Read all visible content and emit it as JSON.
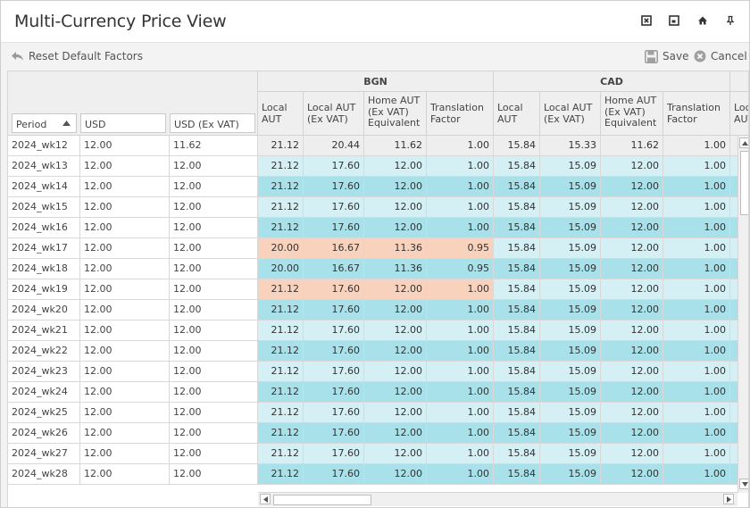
{
  "window": {
    "title": "Multi-Currency Price View",
    "icons": [
      "close-icon",
      "restore-icon",
      "home-icon",
      "pin-icon"
    ]
  },
  "toolbar": {
    "reset_label": "Reset Default Factors",
    "save_label": "Save",
    "cancel_label": "Cancel"
  },
  "grid": {
    "fixed_columns": [
      "Period",
      "USD",
      "USD (Ex VAT)"
    ],
    "sort_column": "Period",
    "groups": [
      {
        "name": "BGN",
        "columns": [
          "Local AUT",
          "Local AUT (Ex VAT)",
          "Home AUT (Ex VAT) Equivalent",
          "Translation Factor"
        ]
      },
      {
        "name": "CAD",
        "columns": [
          "Local AUT",
          "Local AUT (Ex VAT)",
          "Home AUT (Ex VAT) Equivalent",
          "Translation Factor"
        ]
      }
    ],
    "partial_column": "Local AUT",
    "rows": [
      {
        "period": "2024_wk12",
        "usd": "12.00",
        "usd_ex": "11.62",
        "tone": "grey",
        "bgn": [
          "21.12",
          "20.44",
          "11.62",
          "1.00"
        ],
        "cad": [
          "15.84",
          "15.33",
          "11.62",
          "1.00"
        ]
      },
      {
        "period": "2024_wk13",
        "usd": "12.00",
        "usd_ex": "12.00",
        "tone": "light",
        "bgn": [
          "21.12",
          "17.60",
          "12.00",
          "1.00"
        ],
        "cad": [
          "15.84",
          "15.09",
          "12.00",
          "1.00"
        ]
      },
      {
        "period": "2024_wk14",
        "usd": "12.00",
        "usd_ex": "12.00",
        "tone": "dark",
        "bgn": [
          "21.12",
          "17.60",
          "12.00",
          "1.00"
        ],
        "cad": [
          "15.84",
          "15.09",
          "12.00",
          "1.00"
        ]
      },
      {
        "period": "2024_wk15",
        "usd": "12.00",
        "usd_ex": "12.00",
        "tone": "light",
        "bgn": [
          "21.12",
          "17.60",
          "12.00",
          "1.00"
        ],
        "cad": [
          "15.84",
          "15.09",
          "12.00",
          "1.00"
        ]
      },
      {
        "period": "2024_wk16",
        "usd": "12.00",
        "usd_ex": "12.00",
        "tone": "dark",
        "bgn": [
          "21.12",
          "17.60",
          "12.00",
          "1.00"
        ],
        "cad": [
          "15.84",
          "15.09",
          "12.00",
          "1.00"
        ]
      },
      {
        "period": "2024_wk17",
        "usd": "12.00",
        "usd_ex": "12.00",
        "tone": "salmon",
        "bgn": [
          "20.00",
          "16.67",
          "11.36",
          "0.95"
        ],
        "cad": [
          "15.84",
          "15.09",
          "12.00",
          "1.00"
        ]
      },
      {
        "period": "2024_wk18",
        "usd": "12.00",
        "usd_ex": "12.00",
        "tone": "dark",
        "bgn": [
          "20.00",
          "16.67",
          "11.36",
          "0.95"
        ],
        "cad": [
          "15.84",
          "15.09",
          "12.00",
          "1.00"
        ]
      },
      {
        "period": "2024_wk19",
        "usd": "12.00",
        "usd_ex": "12.00",
        "tone": "salmon",
        "bgn": [
          "21.12",
          "17.60",
          "12.00",
          "1.00"
        ],
        "cad": [
          "15.84",
          "15.09",
          "12.00",
          "1.00"
        ]
      },
      {
        "period": "2024_wk20",
        "usd": "12.00",
        "usd_ex": "12.00",
        "tone": "dark",
        "bgn": [
          "21.12",
          "17.60",
          "12.00",
          "1.00"
        ],
        "cad": [
          "15.84",
          "15.09",
          "12.00",
          "1.00"
        ]
      },
      {
        "period": "2024_wk21",
        "usd": "12.00",
        "usd_ex": "12.00",
        "tone": "light",
        "bgn": [
          "21.12",
          "17.60",
          "12.00",
          "1.00"
        ],
        "cad": [
          "15.84",
          "15.09",
          "12.00",
          "1.00"
        ]
      },
      {
        "period": "2024_wk22",
        "usd": "12.00",
        "usd_ex": "12.00",
        "tone": "dark",
        "bgn": [
          "21.12",
          "17.60",
          "12.00",
          "1.00"
        ],
        "cad": [
          "15.84",
          "15.09",
          "12.00",
          "1.00"
        ]
      },
      {
        "period": "2024_wk23",
        "usd": "12.00",
        "usd_ex": "12.00",
        "tone": "light",
        "bgn": [
          "21.12",
          "17.60",
          "12.00",
          "1.00"
        ],
        "cad": [
          "15.84",
          "15.09",
          "12.00",
          "1.00"
        ]
      },
      {
        "period": "2024_wk24",
        "usd": "12.00",
        "usd_ex": "12.00",
        "tone": "dark",
        "bgn": [
          "21.12",
          "17.60",
          "12.00",
          "1.00"
        ],
        "cad": [
          "15.84",
          "15.09",
          "12.00",
          "1.00"
        ]
      },
      {
        "period": "2024_wk25",
        "usd": "12.00",
        "usd_ex": "12.00",
        "tone": "light",
        "bgn": [
          "21.12",
          "17.60",
          "12.00",
          "1.00"
        ],
        "cad": [
          "15.84",
          "15.09",
          "12.00",
          "1.00"
        ]
      },
      {
        "period": "2024_wk26",
        "usd": "12.00",
        "usd_ex": "12.00",
        "tone": "dark",
        "bgn": [
          "21.12",
          "17.60",
          "12.00",
          "1.00"
        ],
        "cad": [
          "15.84",
          "15.09",
          "12.00",
          "1.00"
        ]
      },
      {
        "period": "2024_wk27",
        "usd": "12.00",
        "usd_ex": "12.00",
        "tone": "light",
        "bgn": [
          "21.12",
          "17.60",
          "12.00",
          "1.00"
        ],
        "cad": [
          "15.84",
          "15.09",
          "12.00",
          "1.00"
        ]
      },
      {
        "period": "2024_wk28",
        "usd": "12.00",
        "usd_ex": "12.00",
        "tone": "dark",
        "bgn": [
          "21.12",
          "17.60",
          "12.00",
          "1.00"
        ],
        "cad": [
          "15.84",
          "15.09",
          "12.00",
          "1.00"
        ]
      }
    ]
  },
  "colors": {
    "row_light": "#d4f0f4",
    "row_dark": "#a9e1ea",
    "row_highlight": "#f9d2bd",
    "row_first": "#eeeeee"
  }
}
